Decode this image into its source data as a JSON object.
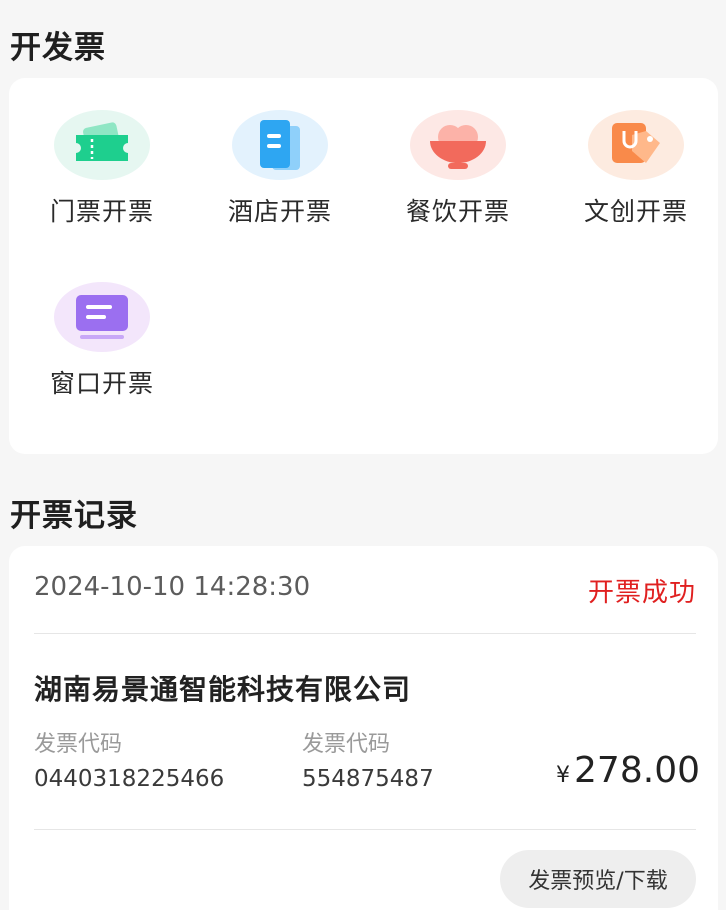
{
  "section_invoice": {
    "title": "开发票"
  },
  "invoice_types": [
    {
      "label": "门票开票",
      "icon": "ticket-icon",
      "color": "#1ecf8e",
      "bg": "#e6f7f1"
    },
    {
      "label": "酒店开票",
      "icon": "hotel-doc-icon",
      "color": "#2ea6f2",
      "bg": "#e3f2fd"
    },
    {
      "label": "餐饮开票",
      "icon": "food-bowl-icon",
      "color": "#f26a5c",
      "bg": "#fde8e5"
    },
    {
      "label": "文创开票",
      "icon": "price-tag-icon",
      "color": "#f98a4a",
      "bg": "#fdebe0"
    },
    {
      "label": "窗口开票",
      "icon": "window-counter-icon",
      "color": "#9b6ff0",
      "bg": "#f3e6fb"
    }
  ],
  "section_records": {
    "title": "开票记录"
  },
  "record": {
    "time": "2024-10-10 14:28:30",
    "status": "开票成功",
    "status_color": "#e02020",
    "company": "湖南易景通智能科技有限公司",
    "field1_label": "发票代码",
    "field1_value": "0440318225466",
    "field2_label": "发票代码",
    "field2_value": "554875487",
    "currency": "¥",
    "amount": "278.00",
    "button_label": "发票预览/下载"
  }
}
